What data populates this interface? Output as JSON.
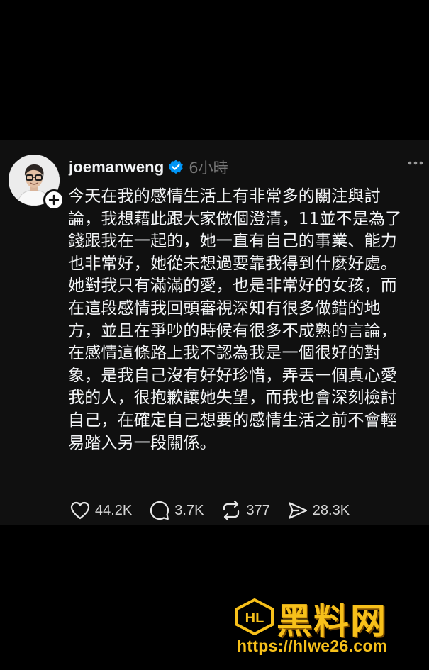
{
  "post": {
    "username": "joemanweng",
    "time": "6小時",
    "body": "今天在我的感情生活上有非常多的關注與討\n論，我想藉此跟大家做個澄清，11並不是為了\n錢跟我在一起的，她一直有自己的事業、能力\n也非常好，她從未想過要靠我得到什麼好處。\n她對我只有滿滿的愛，也是非常好的女孩，而\n在這段感情我回頭審視深知有很多做錯的地\n方，並且在爭吵的時候有很多不成熟的言論，\n在感情這條路上我不認為我是一個很好的對\n象，是我自己沒有好好珍惜，弄丟一個真心愛\n我的人，很抱歉讓她失望，而我也會深刻檢討\n自己，在確定自己想要的感情生活之前不會輕\n易踏入另一段關係。",
    "likes": "44.2K",
    "comments": "3.7K",
    "reposts": "377",
    "shares": "28.3K"
  },
  "icons": {
    "verified": "verified-badge-icon",
    "more": "more-options-icon",
    "like": "heart-icon",
    "comment": "comment-icon",
    "repost": "repost-icon",
    "share": "share-icon",
    "follow": "plus-icon"
  },
  "colors": {
    "background": "#000000",
    "card": "#101010",
    "text": "#f3f5f7",
    "muted": "#777777",
    "verified": "#0095f6",
    "watermark": "#f7c01a"
  },
  "watermark": {
    "logo": "HL",
    "title": "黑料网",
    "url": "https://hlwe26.com"
  }
}
